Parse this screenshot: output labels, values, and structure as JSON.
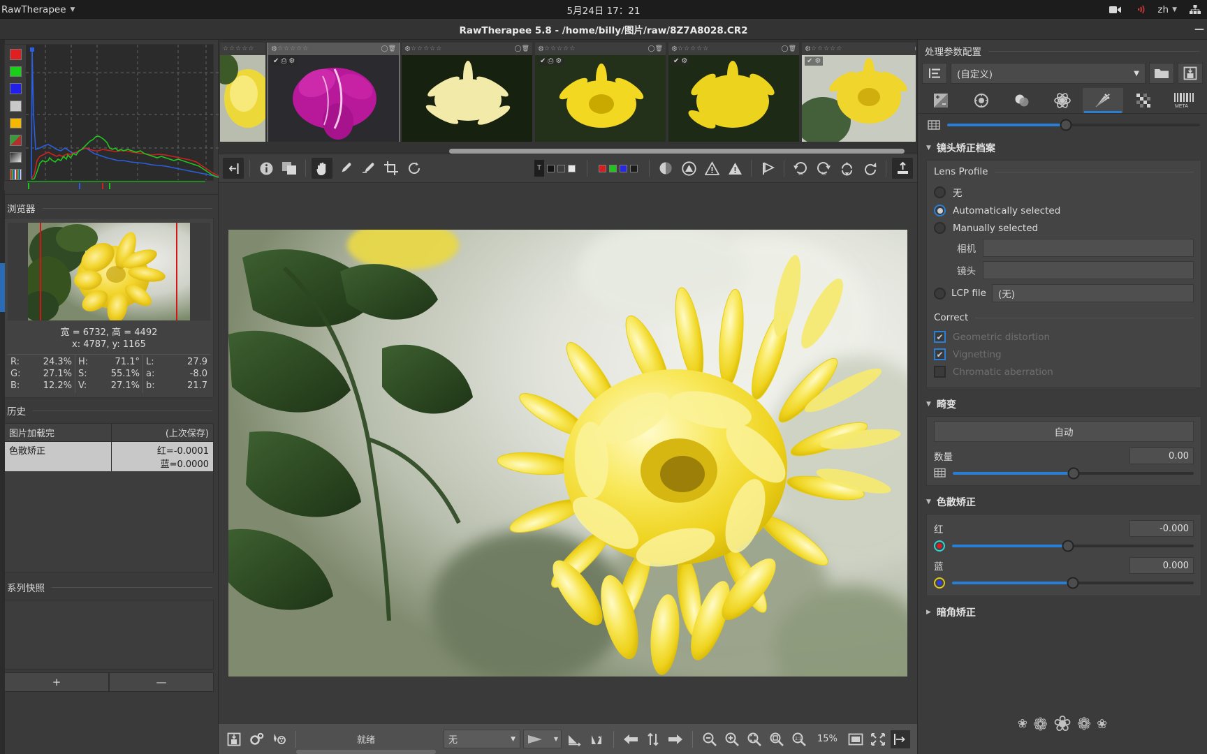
{
  "system_bar": {
    "app_name": "RawTherapee",
    "clock": "5月24日 17：21",
    "language": "zh",
    "icons": [
      "video-camera-icon",
      "wifi-icon",
      "network-icon"
    ]
  },
  "window": {
    "title": "RawTherapee 5.8 - /home/billy/图片/raw/8Z7A8028.CR2",
    "minimize_label": "—"
  },
  "left_panel": {
    "histogram": {
      "buttons": [
        "red-channel",
        "green-channel",
        "blue-channel",
        "luminance",
        "chroma",
        "raw-histogram",
        "gradient",
        "bar-mode"
      ],
      "colors": {
        "red": "#d02020",
        "green": "#1fc41f",
        "blue": "#2a5fe0",
        "grey": "#c8c8c8",
        "orange": "#f0b000"
      }
    },
    "navigator": {
      "title": "浏览器",
      "dimensions": "宽 = 6732, 高 = 4492",
      "coords": "x: 4787, y: 1165",
      "rgb": [
        {
          "key": "R:",
          "value": "24.3%"
        },
        {
          "key": "G:",
          "value": "27.1%"
        },
        {
          "key": "B:",
          "value": "12.2%"
        }
      ],
      "hsv": [
        {
          "key": "H:",
          "value": "71.1°"
        },
        {
          "key": "S:",
          "value": "55.1%"
        },
        {
          "key": "V:",
          "value": "27.1%"
        }
      ],
      "lab": [
        {
          "key": "L:",
          "value": "27.9"
        },
        {
          "key": "a:",
          "value": "-8.0"
        },
        {
          "key": "b:",
          "value": "21.7"
        }
      ]
    },
    "history": {
      "title": "历史",
      "columns": [
        "图片加载完",
        "(上次保存)"
      ],
      "rows": [
        {
          "name": "色散矫正",
          "value_line1": "红=-0.0001",
          "value_line2": "蓝=0.0000",
          "selected": true
        }
      ]
    },
    "snapshots": {
      "title": "系列快照",
      "add_label": "+",
      "remove_label": "—"
    }
  },
  "filmstrip": {
    "items": [
      {
        "name": "thumb-1",
        "stars": "☆☆☆☆☆",
        "selected": false,
        "badges": [],
        "partial": true
      },
      {
        "name": "thumb-2",
        "stars": "☆☆☆☆☆",
        "selected": true,
        "badges": [
          "✔",
          "save-icon",
          "gear-icon"
        ],
        "partial": false
      },
      {
        "name": "thumb-3",
        "stars": "☆☆☆☆☆",
        "selected": false,
        "badges": [],
        "partial": false
      },
      {
        "name": "thumb-4",
        "stars": "☆☆☆☆☆",
        "selected": false,
        "badges": [
          "✔",
          "save-icon",
          "gear-icon"
        ],
        "partial": false
      },
      {
        "name": "thumb-5",
        "stars": "☆☆☆☆☆",
        "selected": false,
        "badges": [
          "✔",
          "gear-icon"
        ],
        "partial": false
      },
      {
        "name": "thumb-6",
        "stars": "☆☆☆☆☆",
        "selected": false,
        "badges": [
          "✔",
          "gear-icon"
        ],
        "partial": false
      }
    ]
  },
  "editor_toolbar": {
    "left_tools": [
      "panel-toggle-icon",
      "info-icon",
      "before-after-icon",
      "hand-tool-icon",
      "white-balance-picker-icon",
      "lock-picker-icon",
      "crop-icon",
      "straighten-icon"
    ],
    "active_tool": "hand-tool-icon",
    "clipping_indicators": [
      "shadow-clip",
      "highlight-clip"
    ],
    "right_tools": [
      "neutral-icon",
      "warn-circle-icon",
      "warn-triangle-icon",
      "warn-triangle-filled-icon",
      "flag-icon",
      "rotate-left-90-icon",
      "rotate-right-90-icon",
      "flip-vertical-icon",
      "flip-horizontal-icon",
      "export-icon"
    ]
  },
  "right_panel": {
    "title": "处理参数配置",
    "profile": {
      "value": "(自定义)",
      "load_icon": "folder-icon",
      "save_icon": "save-icon",
      "list_icon": "profile-list-icon"
    },
    "tabs": [
      {
        "name": "exposure",
        "icon": "exposure-icon",
        "active": false
      },
      {
        "name": "detail",
        "icon": "detail-icon",
        "active": false
      },
      {
        "name": "color",
        "icon": "color-icon",
        "active": false
      },
      {
        "name": "advanced",
        "icon": "advanced-icon",
        "active": false
      },
      {
        "name": "transform",
        "icon": "transform-icon",
        "active": true
      },
      {
        "name": "raw",
        "icon": "raw-icon",
        "active": false
      },
      {
        "name": "metadata",
        "icon": "metadata-icon",
        "active": false,
        "label": "META"
      }
    ],
    "top_slider": {
      "icon": "perspective-icon",
      "percent": 47
    },
    "groups": [
      {
        "title": "镜头矫正档案",
        "expanded": true,
        "subsections": [
          {
            "label": "Lens Profile",
            "radios": [
              {
                "label": "无",
                "selected": false
              },
              {
                "label": "Automatically selected",
                "selected": true
              },
              {
                "label": "Manually selected",
                "selected": false
              }
            ],
            "fields": [
              {
                "label": "相机",
                "value": ""
              },
              {
                "label": "镜头",
                "value": ""
              }
            ],
            "lcp": {
              "label": "LCP file",
              "value": "(无)",
              "selected": false
            }
          },
          {
            "label": "Correct",
            "checkboxes": [
              {
                "label": "Geometric distortion",
                "checked": true,
                "disabled": true
              },
              {
                "label": "Vignetting",
                "checked": true,
                "disabled": true
              },
              {
                "label": "Chromatic aberration",
                "checked": false,
                "disabled": true
              }
            ]
          }
        ]
      },
      {
        "title": "畸变",
        "expanded": true,
        "auto_button": "自动",
        "sliders": [
          {
            "label": "数量",
            "value": "0.00",
            "icon": "grid-icon",
            "percent": 50
          }
        ]
      },
      {
        "title": "色散矫正",
        "expanded": true,
        "sliders": [
          {
            "label": "红",
            "value": "-0.000",
            "icon": "red-dot-icon",
            "percent": 48
          },
          {
            "label": "蓝",
            "value": "0.000",
            "icon": "blue-dot-icon",
            "percent": 50
          }
        ]
      },
      {
        "title": "暗角矫正",
        "expanded": false
      }
    ]
  },
  "status_bar": {
    "icons_left": [
      "save-icon",
      "gear-icon",
      "palette-icon"
    ],
    "status_text": "就绪",
    "queue_select": "无",
    "gradient_select": "gradient-icon",
    "nav_icons": [
      "before-after-icon",
      "compare-icon",
      "previous-image-icon",
      "sort-icon",
      "next-image-icon"
    ],
    "zoom_icons": [
      "zoom-out-icon",
      "zoom-in-icon",
      "zoom-fit-icon",
      "zoom-crop-icon",
      "zoom-100-icon"
    ],
    "zoom_level": "15%",
    "extra_icons": [
      "fullscreen-icon",
      "fit-screen-icon",
      "panel-toggle-icon"
    ]
  }
}
